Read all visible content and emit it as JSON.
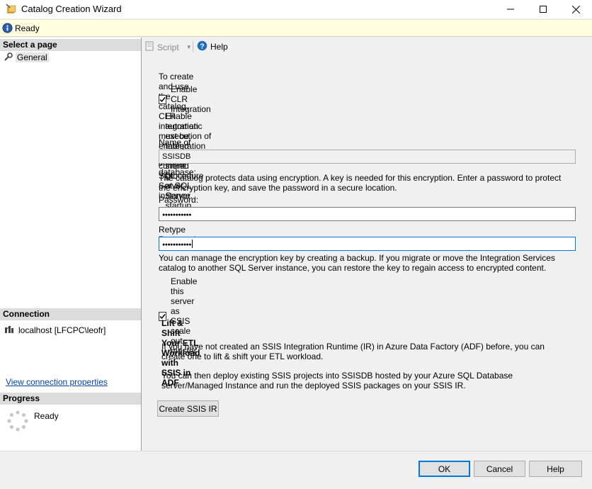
{
  "window": {
    "title": "Catalog Creation Wizard",
    "controls": {
      "minimize": "minimize-icon",
      "maximize": "maximize-icon",
      "close": "close-icon"
    }
  },
  "status": {
    "text": "Ready"
  },
  "sidebar": {
    "select_page_header": "Select a page",
    "pages": [
      {
        "label": "General",
        "selected": true
      }
    ],
    "connection_header": "Connection",
    "connection": "localhost [LFCPC\\leofr]",
    "view_connection_link": "View connection properties",
    "progress_header": "Progress",
    "progress_status": "Ready"
  },
  "toolbar": {
    "script_label": "Script",
    "help_label": "Help"
  },
  "form": {
    "clr_notice": "To create and use the catalog, CLR integration must be enabled on the current SQL Server instance.",
    "enable_clr": {
      "label": "Enable CLR Integration",
      "checked": true
    },
    "auto_exec": {
      "label": "Enable automatic execution of Integration Services stored procedure at SQL Server startup.",
      "checked": false
    },
    "catalog_name_label": "Name of the catalog database:",
    "catalog_name_value": "SSISDB",
    "encryption_notice": "The catalog protects data using encryption. A key is needed for this encryption. Enter a password to protect the encryption key, and save the password in a secure location.",
    "password_label": "Password:",
    "password_value": "●●●●●●●●●●●",
    "retype_label": "Retype Password:",
    "retype_value": "●●●●●●●●●●●",
    "backup_notice": "You can manage the encryption key by creating a backup. If you migrate or move the Integration Services catalog to another SQL Server instance, you can restore the key to regain access to encrypted content.",
    "scale_out": {
      "label": "Enable this server as SSIS scale out master",
      "checked": true
    }
  },
  "adf": {
    "heading": "Lift & Shift Your ETL Workload with SSIS in ADF",
    "para1": "If you have not created an SSIS Integration Runtime (IR) in Azure Data Factory (ADF) before, you can create one to lift & shift your ETL workload.",
    "para2": "You can then deploy existing SSIS projects into SSISDB hosted by your Azure SQL Database server/Managed Instance and run the deployed SSIS packages on your SSIS IR.",
    "create_button": "Create SSIS IR"
  },
  "buttons": {
    "ok": "OK",
    "cancel": "Cancel",
    "help": "Help"
  }
}
